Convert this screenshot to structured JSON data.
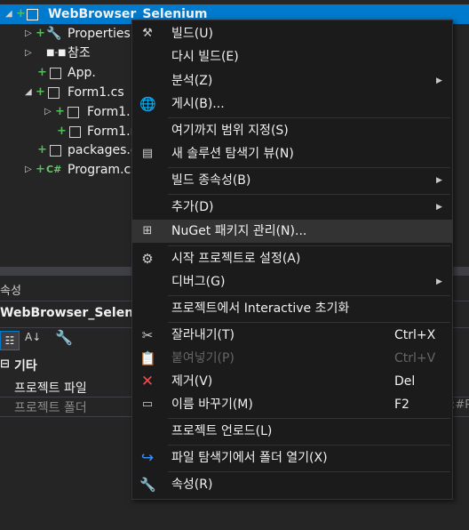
{
  "tree": {
    "project": "WebBrowser_Selenium",
    "items": [
      "Properties",
      "참조",
      "App.",
      "Form1.cs",
      "Form1.D",
      "Form1.r",
      "packages.c",
      "Program.cs"
    ]
  },
  "properties": {
    "title": "속성",
    "object": "WebBrowser_Seleniu",
    "category": "기타",
    "rows": [
      {
        "name": "프로젝트 파일",
        "value": ""
      },
      {
        "name": "프로젝트 폴더",
        "value": ":#Pr"
      }
    ]
  },
  "menu": {
    "items": [
      {
        "label": "빌드(U)",
        "icon": "build-icon"
      },
      {
        "label": "다시 빌드(E)"
      },
      {
        "label": "분석(Z)",
        "submenu": true
      },
      {
        "label": "게시(B)...",
        "icon": "publish-globe-icon"
      },
      {
        "label": "여기까지 범위 지정(S)"
      },
      {
        "label": "새 솔루션 탐색기 뷰(N)",
        "icon": "new-view-icon"
      },
      {
        "label": "빌드 종속성(B)",
        "submenu": true
      },
      {
        "label": "추가(D)",
        "submenu": true
      },
      {
        "label": "NuGet 패키지 관리(N)...",
        "icon": "nuget-package-icon"
      },
      {
        "label": "시작 프로젝트로 설정(A)",
        "icon": "gear-icon"
      },
      {
        "label": "디버그(G)",
        "submenu": true
      },
      {
        "label": "프로젝트에서 Interactive 초기화"
      },
      {
        "label": "잘라내기(T)",
        "icon": "scissors-icon",
        "shortcut": "Ctrl+X"
      },
      {
        "label": "붙여넣기(P)",
        "icon": "paste-icon",
        "shortcut": "Ctrl+V",
        "disabled": true
      },
      {
        "label": "제거(V)",
        "icon": "remove-x-icon",
        "shortcut": "Del"
      },
      {
        "label": "이름 바꾸기(M)",
        "icon": "rename-icon",
        "shortcut": "F2"
      },
      {
        "label": "프로젝트 언로드(L)"
      },
      {
        "label": "파일 탐색기에서 폴더 열기(X)",
        "icon": "open-folder-arrow-icon"
      },
      {
        "label": "속성(R)",
        "icon": "wrench-icon"
      }
    ]
  }
}
